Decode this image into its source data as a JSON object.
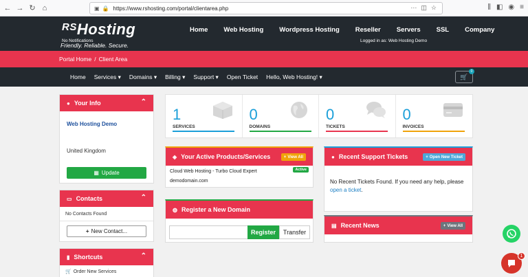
{
  "browser": {
    "url": "https://www.rshosting.com/portal/clientarea.php",
    "url_menu": "···"
  },
  "logo": {
    "rs": "RS",
    "name": "Hosting",
    "tagline": "Friendly. Reliable. Secure."
  },
  "main_nav": [
    "Home",
    "Web Hosting",
    "Wordpress Hosting",
    "Reseller",
    "Servers",
    "SSL",
    "Company"
  ],
  "strip": {
    "left": "No Notifications",
    "right": "Logged in as:   Web Hosting Demo"
  },
  "breadcrumb": {
    "home": "Portal Home",
    "sep": "/",
    "current": "Client Area"
  },
  "sub_nav": [
    "Home",
    "Services ▾",
    "Domains ▾",
    "Billing ▾",
    "Support ▾",
    "Open Ticket",
    "Hello, Web Hosting! ▾"
  ],
  "cart": {
    "count": "0"
  },
  "your_info": {
    "title": "Your Info",
    "name": "Web Hosting Demo",
    "country": "United Kingdom",
    "update_label": "Update"
  },
  "contacts": {
    "title": "Contacts",
    "none_text": "No Contacts Found",
    "new_label": "New Contact..."
  },
  "shortcuts": {
    "title": "Shortcuts",
    "item": "Order New Services"
  },
  "stats": [
    {
      "value": "1",
      "label": "SERVICES",
      "color": "#1b9fd9"
    },
    {
      "value": "0",
      "label": "DOMAINS",
      "color": "#22a844"
    },
    {
      "value": "0",
      "label": "TICKETS",
      "color": "#e8344e"
    },
    {
      "value": "0",
      "label": "INVOICES",
      "color": "#f0a30a"
    }
  ],
  "products": {
    "title": "Your Active Products/Services",
    "view_all": "View All",
    "name": "Cloud Web Hosting - Turbo Cloud Expert",
    "domain": "demodomain.com",
    "status": "Active"
  },
  "tickets": {
    "title": "Recent Support Tickets",
    "open_new": "Open New Ticket",
    "text": "No Recent Tickets Found. If you need any help, please",
    "link": "open a ticket"
  },
  "register_domain": {
    "title": "Register a New Domain",
    "register_label": "Register",
    "transfer_label": "Transfer"
  },
  "news": {
    "title": "Recent News",
    "view_all": "View All"
  },
  "chat_badge": "1"
}
